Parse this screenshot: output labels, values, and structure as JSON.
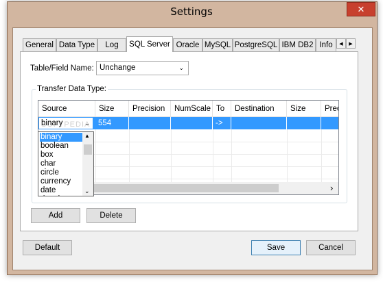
{
  "window": {
    "title": "Settings",
    "close_glyph": "✕"
  },
  "tabs": [
    {
      "label": "General"
    },
    {
      "label": "Data Type"
    },
    {
      "label": "Log"
    },
    {
      "label": "SQL Server"
    },
    {
      "label": "Oracle"
    },
    {
      "label": "MySQL"
    },
    {
      "label": "PostgreSQL"
    },
    {
      "label": "IBM DB2"
    },
    {
      "label": "Info"
    }
  ],
  "active_tab": "SQL Server",
  "tab_scroll": {
    "left": "◀",
    "right": "▶"
  },
  "table_field": {
    "label": "Table/Field Name:",
    "value": "Unchange"
  },
  "transfer": {
    "group_label": "Transfer Data Type:",
    "columns": [
      "Source",
      "Size",
      "Precision",
      "NumScale",
      "To",
      "Destination",
      "Size",
      "Prec"
    ],
    "selected_row": {
      "source": "binary",
      "size": "554",
      "to": "->"
    },
    "dropdown_options": [
      "binary",
      "boolean",
      "box",
      "char",
      "circle",
      "currency",
      "date",
      "datetime"
    ],
    "scroll_right": "›",
    "watermark": "SOFTPEDIA"
  },
  "buttons": {
    "add": "Add",
    "delete": "Delete",
    "default": "Default",
    "save": "Save",
    "cancel": "Cancel"
  },
  "icons": {
    "chevron": "⌄"
  }
}
